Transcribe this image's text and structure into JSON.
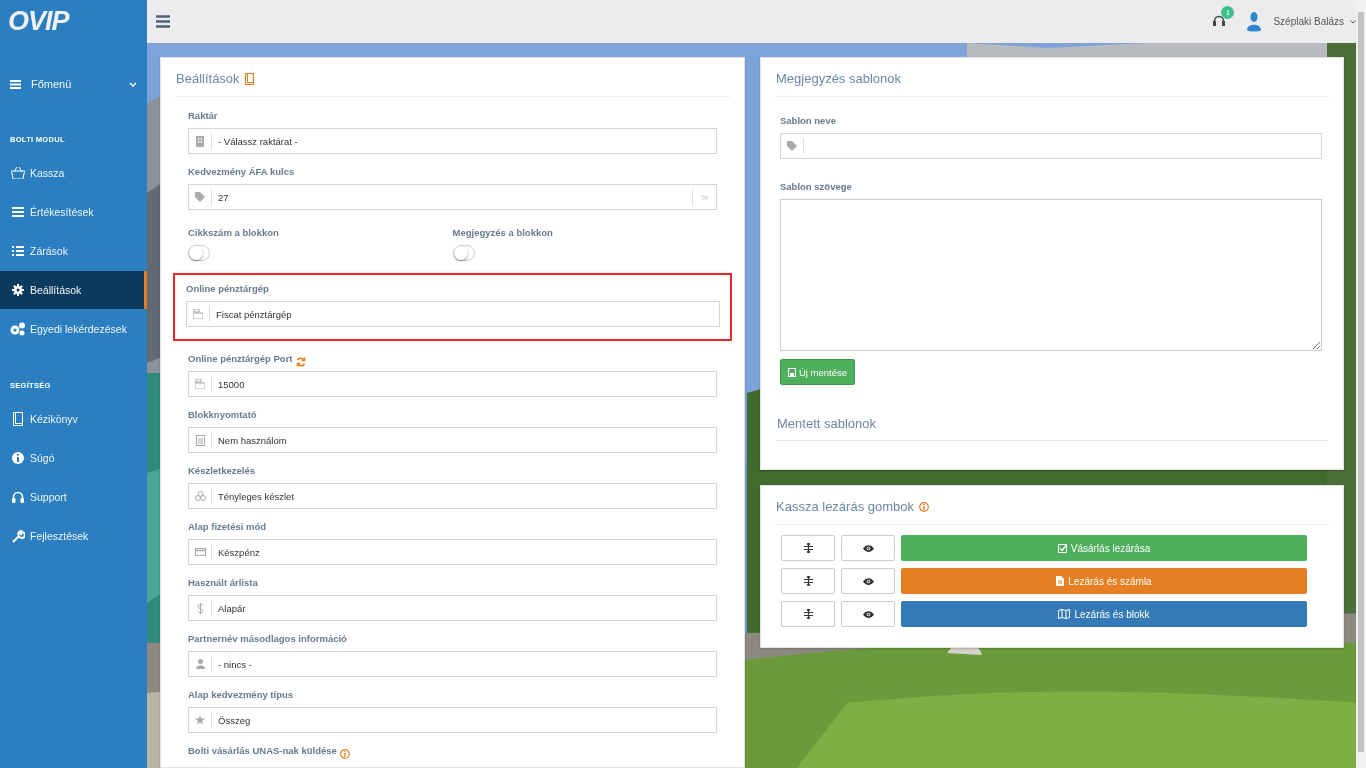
{
  "sidebar": {
    "logo": "OVIP",
    "main_menu": {
      "label": "Főmenü",
      "expanded": false
    },
    "sections": [
      {
        "title": "BOLTI MODUL",
        "items": [
          {
            "label": "Kassza",
            "selected": false
          },
          {
            "label": "Értékesítések",
            "selected": false
          },
          {
            "label": "Zárások",
            "selected": false
          },
          {
            "label": "Beállítások",
            "selected": true
          },
          {
            "label": "Egyedi lekérdezések",
            "selected": false
          }
        ]
      },
      {
        "title": "SEGÍTSÉG",
        "items": [
          {
            "label": "Kézikönyv",
            "selected": false
          },
          {
            "label": "Súgó",
            "selected": false
          },
          {
            "label": "Support",
            "selected": false
          },
          {
            "label": "Fejlesztések",
            "selected": false
          }
        ]
      }
    ]
  },
  "topbar": {
    "notification_count": "1",
    "user_name": "Széplaki Balázs"
  },
  "settings": {
    "title": "Beállítások",
    "fields": [
      {
        "kind": "field",
        "label": "Raktár",
        "value": "- Válassz raktárat -",
        "highlighted": false
      },
      {
        "kind": "field",
        "label": "Kedvezmény ÁFA kulcs",
        "value": "27",
        "suffix": "%",
        "highlighted": false
      },
      {
        "kind": "toggles",
        "toggles": [
          {
            "label": "Cikkszám a blokkon",
            "on": false
          },
          {
            "label": "Megjegyzés a blokkon",
            "on": false
          }
        ]
      },
      {
        "kind": "field",
        "label": "Online pénztárgép",
        "value": "Fiscat pénztárgép",
        "highlighted": true
      },
      {
        "kind": "field",
        "label": "Online pénztárgép Port",
        "value": "15000",
        "highlighted": false
      },
      {
        "kind": "field",
        "label": "Blokknyomtató",
        "value": "Nem használom",
        "highlighted": false
      },
      {
        "kind": "field",
        "label": "Készletkezelés",
        "value": "Tényleges készlet",
        "highlighted": false
      },
      {
        "kind": "field",
        "label": "Alap fizetési mód",
        "value": "Készpénz",
        "highlighted": false
      },
      {
        "kind": "field",
        "label": "Használt árlista",
        "value": "Alapár",
        "highlighted": false
      },
      {
        "kind": "field",
        "label": "Partnernév másodlagos információ",
        "value": "- nincs -",
        "highlighted": false
      },
      {
        "kind": "field",
        "label": "Alap kedvezmény típus",
        "value": "Összeg",
        "highlighted": false
      },
      {
        "kind": "heading",
        "label": "Bolti vásárlás UNAS-nak küldése"
      }
    ]
  },
  "templates": {
    "title": "Megjegyzés sablonok",
    "name_label": "Sablon neve",
    "text_label": "Sablon szövege",
    "save_button": "Új mentése",
    "saved_title": "Mentett sablonok"
  },
  "closing_buttons": {
    "title": "Kassza lezárás gombok",
    "rows": [
      {
        "label": "Vásárlás lezárása",
        "color": "#4fae5c"
      },
      {
        "label": "Lezárás és számla",
        "color": "#e67e22"
      },
      {
        "label": "Lezárás és blokk",
        "color": "#337ab7"
      }
    ]
  }
}
